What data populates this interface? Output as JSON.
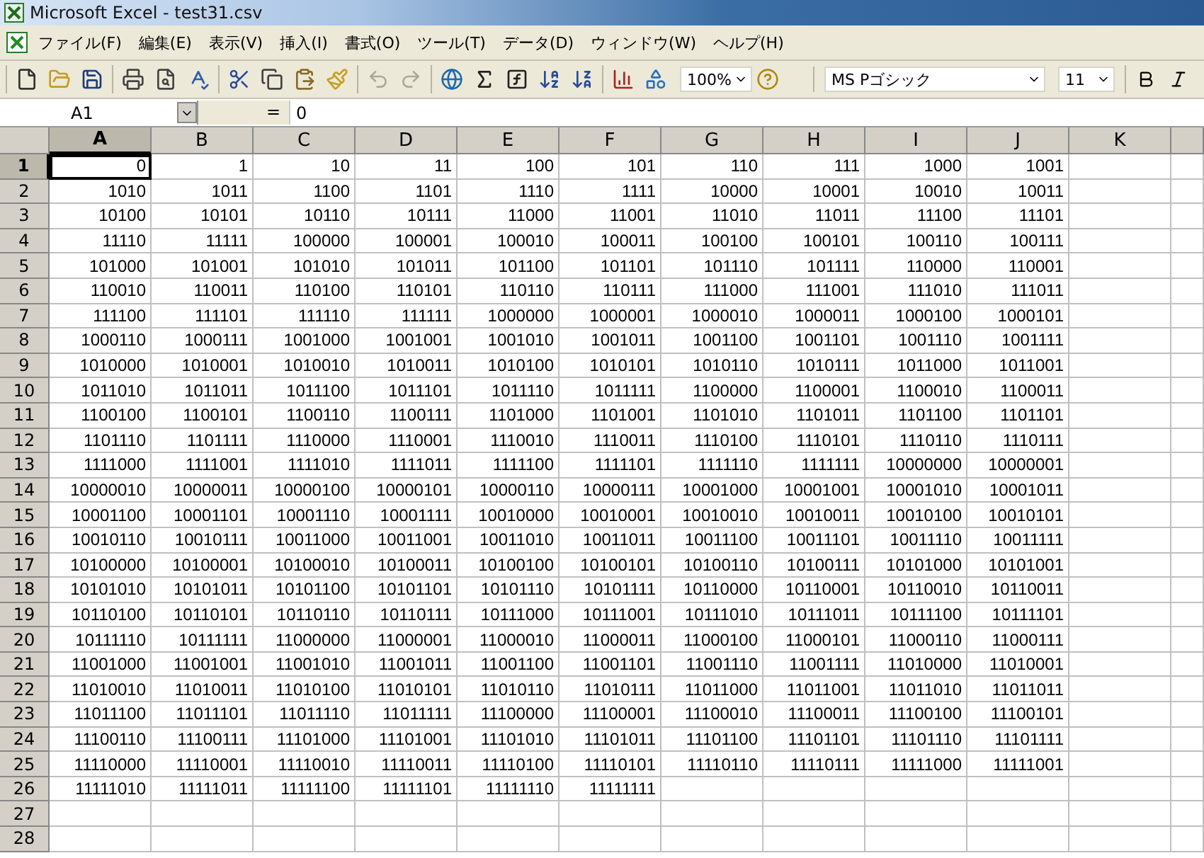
{
  "window": {
    "title": "Microsoft Excel - test31.csv"
  },
  "menu": [
    "ファイル(F)",
    "編集(E)",
    "表示(V)",
    "挿入(I)",
    "書式(O)",
    "ツール(T)",
    "データ(D)",
    "ウィンドウ(W)",
    "ヘルプ(H)"
  ],
  "toolbar": {
    "groups": [
      [
        {
          "kind": "new",
          "disabled": false
        },
        {
          "kind": "open",
          "disabled": false
        },
        {
          "kind": "save",
          "disabled": false
        }
      ],
      [
        {
          "kind": "print",
          "disabled": false
        },
        {
          "kind": "preview",
          "disabled": false
        },
        {
          "kind": "spelling",
          "disabled": false
        }
      ],
      [
        {
          "kind": "cut",
          "disabled": false
        },
        {
          "kind": "copy",
          "disabled": false
        },
        {
          "kind": "paste",
          "disabled": false
        },
        {
          "kind": "format-painter",
          "disabled": false
        }
      ],
      [
        {
          "kind": "undo",
          "disabled": true
        },
        {
          "kind": "redo",
          "disabled": true
        }
      ],
      [
        {
          "kind": "hyperlink",
          "disabled": false
        },
        {
          "kind": "sum",
          "disabled": false
        },
        {
          "kind": "function",
          "disabled": false
        },
        {
          "kind": "sort-asc",
          "disabled": false
        },
        {
          "kind": "sort-desc",
          "disabled": false
        }
      ],
      [
        {
          "kind": "chart",
          "disabled": false
        },
        {
          "kind": "drawing",
          "disabled": false
        }
      ]
    ],
    "zoom": "100%",
    "font": "MS Pゴシック",
    "font_size": "11",
    "format": [
      {
        "kind": "bold",
        "disabled": false
      },
      {
        "kind": "italic",
        "disabled": false
      }
    ]
  },
  "formula_bar": {
    "name_box": "A1",
    "equals": "=",
    "value": "0"
  },
  "columns": [
    {
      "label": "A",
      "selected": true
    },
    {
      "label": "B",
      "selected": false
    },
    {
      "label": "C",
      "selected": false
    },
    {
      "label": "D",
      "selected": false
    },
    {
      "label": "E",
      "selected": false
    },
    {
      "label": "F",
      "selected": false
    },
    {
      "label": "G",
      "selected": false
    },
    {
      "label": "H",
      "selected": false
    },
    {
      "label": "I",
      "selected": false
    },
    {
      "label": "J",
      "selected": false
    },
    {
      "label": "K",
      "selected": false
    }
  ],
  "rows": [
    {
      "label": "1",
      "selected": true,
      "cells": [
        "0",
        "1",
        "10",
        "11",
        "100",
        "101",
        "110",
        "111",
        "1000",
        "1001"
      ]
    },
    {
      "label": "2",
      "selected": false,
      "cells": [
        "1010",
        "1011",
        "1100",
        "1101",
        "1110",
        "1111",
        "10000",
        "10001",
        "10010",
        "10011"
      ]
    },
    {
      "label": "3",
      "selected": false,
      "cells": [
        "10100",
        "10101",
        "10110",
        "10111",
        "11000",
        "11001",
        "11010",
        "11011",
        "11100",
        "11101"
      ]
    },
    {
      "label": "4",
      "selected": false,
      "cells": [
        "11110",
        "11111",
        "100000",
        "100001",
        "100010",
        "100011",
        "100100",
        "100101",
        "100110",
        "100111"
      ]
    },
    {
      "label": "5",
      "selected": false,
      "cells": [
        "101000",
        "101001",
        "101010",
        "101011",
        "101100",
        "101101",
        "101110",
        "101111",
        "110000",
        "110001"
      ]
    },
    {
      "label": "6",
      "selected": false,
      "cells": [
        "110010",
        "110011",
        "110100",
        "110101",
        "110110",
        "110111",
        "111000",
        "111001",
        "111010",
        "111011"
      ]
    },
    {
      "label": "7",
      "selected": false,
      "cells": [
        "111100",
        "111101",
        "111110",
        "111111",
        "1000000",
        "1000001",
        "1000010",
        "1000011",
        "1000100",
        "1000101"
      ]
    },
    {
      "label": "8",
      "selected": false,
      "cells": [
        "1000110",
        "1000111",
        "1001000",
        "1001001",
        "1001010",
        "1001011",
        "1001100",
        "1001101",
        "1001110",
        "1001111"
      ]
    },
    {
      "label": "9",
      "selected": false,
      "cells": [
        "1010000",
        "1010001",
        "1010010",
        "1010011",
        "1010100",
        "1010101",
        "1010110",
        "1010111",
        "1011000",
        "1011001"
      ]
    },
    {
      "label": "10",
      "selected": false,
      "cells": [
        "1011010",
        "1011011",
        "1011100",
        "1011101",
        "1011110",
        "1011111",
        "1100000",
        "1100001",
        "1100010",
        "1100011"
      ]
    },
    {
      "label": "11",
      "selected": false,
      "cells": [
        "1100100",
        "1100101",
        "1100110",
        "1100111",
        "1101000",
        "1101001",
        "1101010",
        "1101011",
        "1101100",
        "1101101"
      ]
    },
    {
      "label": "12",
      "selected": false,
      "cells": [
        "1101110",
        "1101111",
        "1110000",
        "1110001",
        "1110010",
        "1110011",
        "1110100",
        "1110101",
        "1110110",
        "1110111"
      ]
    },
    {
      "label": "13",
      "selected": false,
      "cells": [
        "1111000",
        "1111001",
        "1111010",
        "1111011",
        "1111100",
        "1111101",
        "1111110",
        "1111111",
        "10000000",
        "10000001"
      ]
    },
    {
      "label": "14",
      "selected": false,
      "cells": [
        "10000010",
        "10000011",
        "10000100",
        "10000101",
        "10000110",
        "10000111",
        "10001000",
        "10001001",
        "10001010",
        "10001011"
      ]
    },
    {
      "label": "15",
      "selected": false,
      "cells": [
        "10001100",
        "10001101",
        "10001110",
        "10001111",
        "10010000",
        "10010001",
        "10010010",
        "10010011",
        "10010100",
        "10010101"
      ]
    },
    {
      "label": "16",
      "selected": false,
      "cells": [
        "10010110",
        "10010111",
        "10011000",
        "10011001",
        "10011010",
        "10011011",
        "10011100",
        "10011101",
        "10011110",
        "10011111"
      ]
    },
    {
      "label": "17",
      "selected": false,
      "cells": [
        "10100000",
        "10100001",
        "10100010",
        "10100011",
        "10100100",
        "10100101",
        "10100110",
        "10100111",
        "10101000",
        "10101001"
      ]
    },
    {
      "label": "18",
      "selected": false,
      "cells": [
        "10101010",
        "10101011",
        "10101100",
        "10101101",
        "10101110",
        "10101111",
        "10110000",
        "10110001",
        "10110010",
        "10110011"
      ]
    },
    {
      "label": "19",
      "selected": false,
      "cells": [
        "10110100",
        "10110101",
        "10110110",
        "10110111",
        "10111000",
        "10111001",
        "10111010",
        "10111011",
        "10111100",
        "10111101"
      ]
    },
    {
      "label": "20",
      "selected": false,
      "cells": [
        "10111110",
        "10111111",
        "11000000",
        "11000001",
        "11000010",
        "11000011",
        "11000100",
        "11000101",
        "11000110",
        "11000111"
      ]
    },
    {
      "label": "21",
      "selected": false,
      "cells": [
        "11001000",
        "11001001",
        "11001010",
        "11001011",
        "11001100",
        "11001101",
        "11001110",
        "11001111",
        "11010000",
        "11010001"
      ]
    },
    {
      "label": "22",
      "selected": false,
      "cells": [
        "11010010",
        "11010011",
        "11010100",
        "11010101",
        "11010110",
        "11010111",
        "11011000",
        "11011001",
        "11011010",
        "11011011"
      ]
    },
    {
      "label": "23",
      "selected": false,
      "cells": [
        "11011100",
        "11011101",
        "11011110",
        "11011111",
        "11100000",
        "11100001",
        "11100010",
        "11100011",
        "11100100",
        "11100101"
      ]
    },
    {
      "label": "24",
      "selected": false,
      "cells": [
        "11100110",
        "11100111",
        "11101000",
        "11101001",
        "11101010",
        "11101011",
        "11101100",
        "11101101",
        "11101110",
        "11101111"
      ]
    },
    {
      "label": "25",
      "selected": false,
      "cells": [
        "11110000",
        "11110001",
        "11110010",
        "11110011",
        "11110100",
        "11110101",
        "11110110",
        "11110111",
        "11111000",
        "11111001"
      ]
    },
    {
      "label": "26",
      "selected": false,
      "cells": [
        "11111010",
        "11111011",
        "11111100",
        "11111101",
        "11111110",
        "11111111"
      ]
    },
    {
      "label": "27",
      "selected": false,
      "cells": []
    },
    {
      "label": "28",
      "selected": false,
      "cells": []
    }
  ]
}
